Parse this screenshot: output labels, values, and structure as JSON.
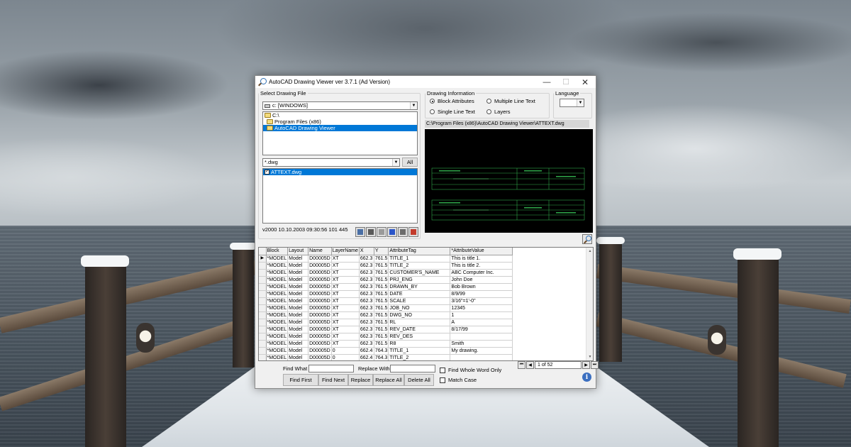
{
  "window": {
    "title": "AutoCAD Drawing Viewer ver 3.7.1  (Ad Version)",
    "controls": {
      "minimize": "—",
      "maximize": "☐",
      "close": "✕"
    }
  },
  "select_file": {
    "legend": "Select Drawing File",
    "drive": "c: [WINDOWS]",
    "folders": [
      {
        "label": "C:\\",
        "selected": false
      },
      {
        "label": "Program Files (x86)",
        "selected": false
      },
      {
        "label": "AutoCAD Drawing Viewer",
        "selected": true
      }
    ],
    "filter": "*.dwg",
    "all_button": "All",
    "files": [
      {
        "label": "ATTEXT.dwg",
        "checked": true,
        "selected": true
      }
    ],
    "status": "v2000  10.10.2003 09:30:56  101 445",
    "tool_icons": [
      "preview-icon",
      "open-icon",
      "print-icon",
      "image-icon",
      "export-icon",
      "wrench-icon"
    ]
  },
  "drawing_info": {
    "legend": "Drawing Information",
    "options": [
      {
        "label": "Block Attributes",
        "checked": true
      },
      {
        "label": "Multiple Line Text",
        "checked": false
      },
      {
        "label": "Single Line Text",
        "checked": false
      },
      {
        "label": "Layers",
        "checked": false
      }
    ]
  },
  "language": {
    "legend": "Language",
    "value": ""
  },
  "path": "C:\\Program Files (x86)\\AutoCAD Drawing Viewer\\ATTEXT.dwg",
  "grid": {
    "columns": [
      "Block",
      "Layout",
      "Name",
      "LayerName",
      "X",
      "Y",
      "AttributeTag",
      "*AttributeValue"
    ],
    "rows": [
      [
        "*MODEL",
        "Model",
        "D00005D",
        "XT",
        "662.3",
        "761.5",
        "TITLE_1",
        "This is title 1."
      ],
      [
        "*MODEL",
        "Model",
        "D00005D",
        "XT",
        "662.3",
        "761.5",
        "TITLE_2",
        "This is title 2."
      ],
      [
        "*MODEL",
        "Model",
        "D00005D",
        "XT",
        "662.3",
        "761.5",
        "CUSTOMER'S_NAME",
        "ABC Computer Inc."
      ],
      [
        "*MODEL",
        "Model",
        "D00005D",
        "XT",
        "662.3",
        "761.5",
        "PRJ_ENG",
        "John Doe"
      ],
      [
        "*MODEL",
        "Model",
        "D00005D",
        "XT",
        "662.3",
        "761.5",
        "DRAWN_BY",
        "Bob Brown"
      ],
      [
        "*MODEL",
        "Model",
        "D00005D",
        "XT",
        "662.3",
        "761.5",
        "DATE",
        "8/9/99"
      ],
      [
        "*MODEL",
        "Model",
        "D00005D",
        "XT",
        "662.3",
        "761.5",
        "SCALE",
        "3/16\"=1'-0\""
      ],
      [
        "*MODEL",
        "Model",
        "D00005D",
        "XT",
        "662.3",
        "761.5",
        "JOB_NO",
        "12345"
      ],
      [
        "*MODEL",
        "Model",
        "D00005D",
        "XT",
        "662.3",
        "761.5",
        "DWG_NO",
        "1"
      ],
      [
        "*MODEL",
        "Model",
        "D00005D",
        "XT",
        "662.3",
        "761.5",
        "RL",
        "A"
      ],
      [
        "*MODEL",
        "Model",
        "D00005D",
        "XT",
        "662.3",
        "761.5",
        "REV_DATE",
        "8/17/99"
      ],
      [
        "*MODEL",
        "Model",
        "D00005D",
        "XT",
        "662.3",
        "761.5",
        "REV_DES",
        ""
      ],
      [
        "*MODEL",
        "Model",
        "D00005D",
        "XT",
        "662.3",
        "761.5",
        "R8",
        "Smith"
      ],
      [
        "*MODEL",
        "Model",
        "D00005D",
        "0",
        "662.4",
        "764.3",
        "TITLE_1",
        "My drawing."
      ],
      [
        "*MODEL",
        "Model",
        "D00005D",
        "0",
        "662.4",
        "764.3",
        "TITLE_2",
        ""
      ]
    ],
    "current_row_marker": "▶"
  },
  "pager": {
    "first": "⏮",
    "prev": "◀",
    "value": "1 of 52",
    "next": "▶",
    "last": "⏭"
  },
  "find": {
    "find_what_label": "Find What",
    "find_what_value": "",
    "replace_with_label": "Replace With",
    "replace_with_value": "",
    "whole_word_label": "Find Whole Word Only",
    "match_case_label": "Match Case",
    "buttons": {
      "find_first": "Find First",
      "find_next": "Find Next",
      "replace": "Replace",
      "replace_all": "Replace All",
      "delete_all": "Delete All"
    }
  }
}
